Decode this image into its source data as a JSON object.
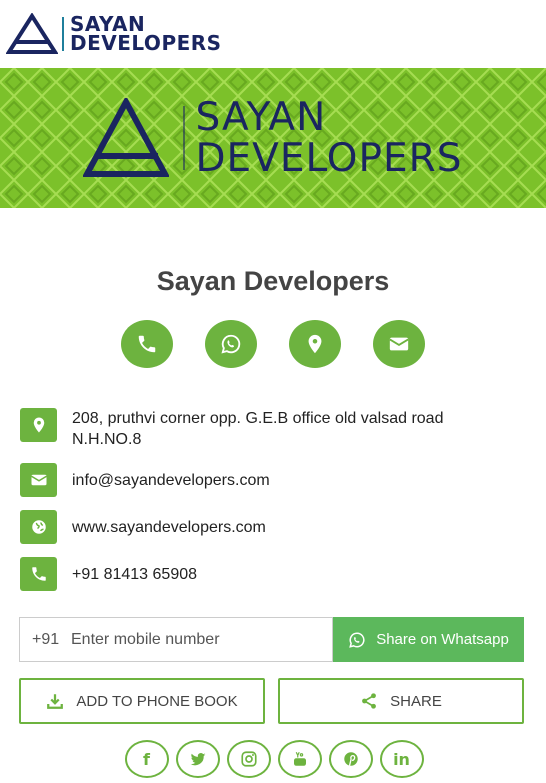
{
  "header": {
    "logo_line1": "SAYAN",
    "logo_line2": "DEVELOPERS"
  },
  "banner": {
    "logo_line1": "SAYAN",
    "logo_line2": "DEVELOPERS"
  },
  "company": {
    "name": "Sayan Developers"
  },
  "quick_actions": [
    {
      "icon": "phone-icon"
    },
    {
      "icon": "whatsapp-icon"
    },
    {
      "icon": "location-icon"
    },
    {
      "icon": "email-icon"
    }
  ],
  "contact": {
    "address": "208, pruthvi corner opp. G.E.B office old valsad road N.H.NO.8",
    "email": "info@sayandevelopers.com",
    "website": "www.sayandevelopers.com",
    "phone": "+91 81413 65908"
  },
  "whatsapp_share": {
    "prefix": "+91",
    "placeholder": "Enter mobile number",
    "button_label": "Share on Whatsapp"
  },
  "buttons": {
    "add_phonebook": "ADD TO PHONE BOOK",
    "share": "SHARE"
  },
  "social": [
    {
      "icon": "facebook-icon",
      "glyph": "f"
    },
    {
      "icon": "twitter-icon"
    },
    {
      "icon": "instagram-icon"
    },
    {
      "icon": "youtube-icon"
    },
    {
      "icon": "pinterest-icon"
    },
    {
      "icon": "linkedin-icon",
      "glyph": "in"
    }
  ],
  "colors": {
    "accent": "#6db33f",
    "banner_green": "#7cc12a",
    "brand_navy": "#1a2560",
    "whatsapp_green": "#5cb85c"
  }
}
